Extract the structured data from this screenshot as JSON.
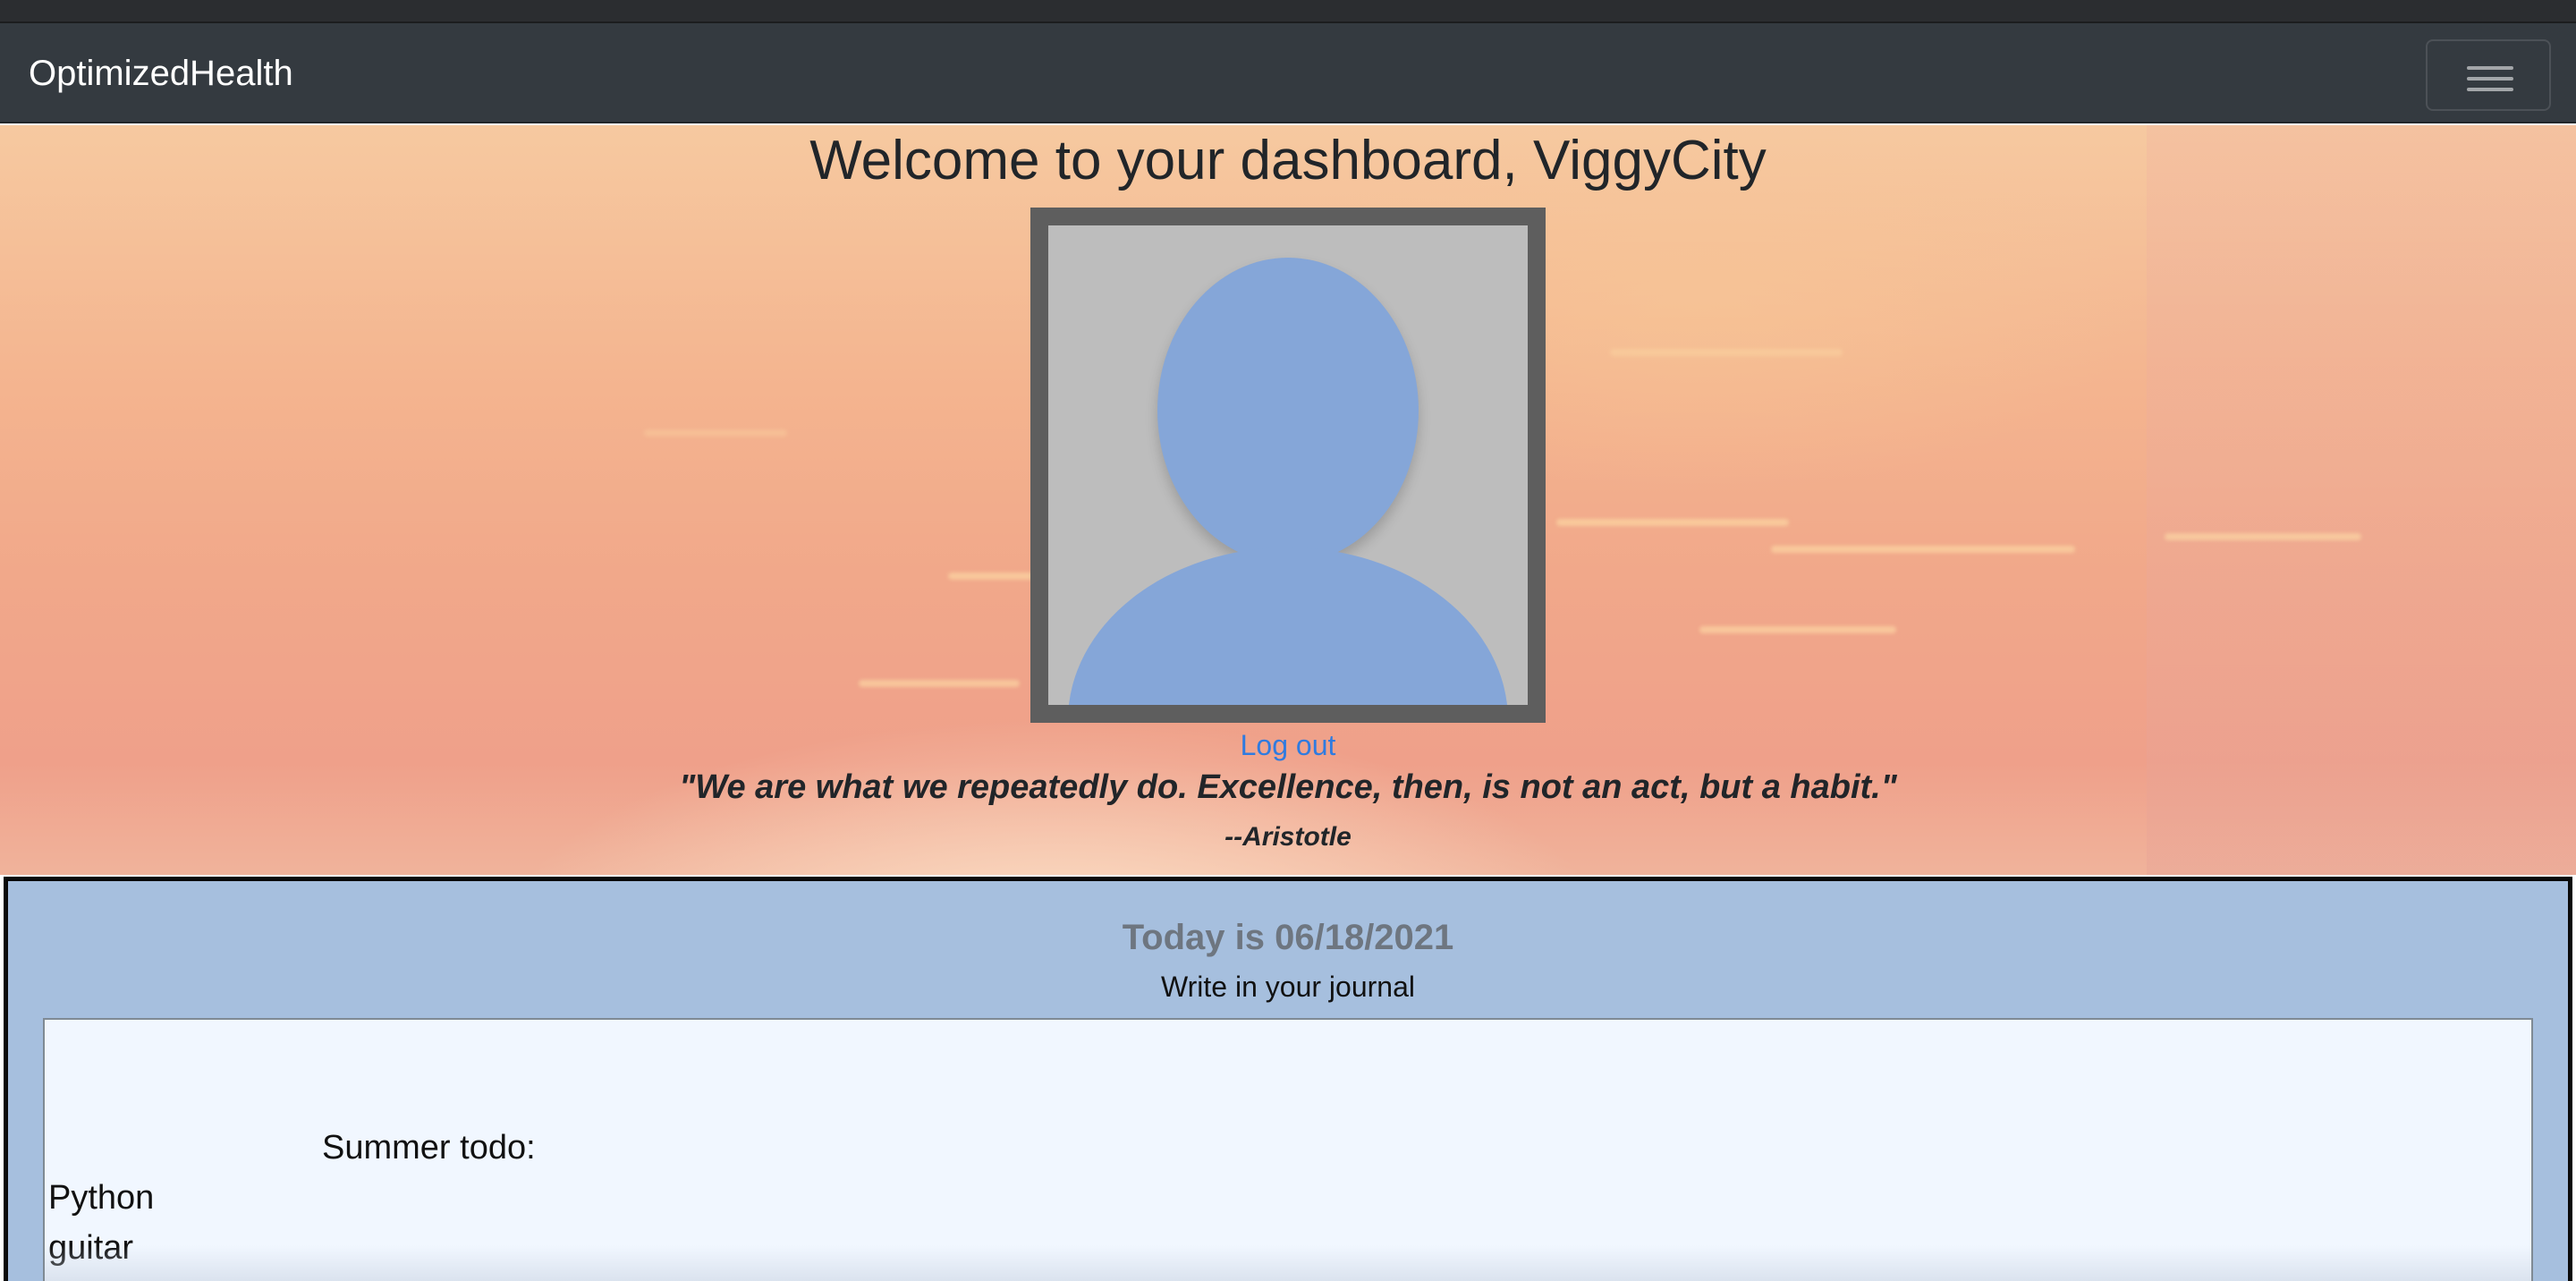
{
  "navbar": {
    "brand": "OptimizedHealth",
    "menu_icon": "hamburger-menu-icon"
  },
  "hero": {
    "welcome": "Welcome to your dashboard, ViggyCity",
    "avatar_icon": "default-user-avatar-icon",
    "logout_label": "Log out",
    "quote": "\"We are what we repeatedly do. Excellence, then, is not an act, but a habit.\"",
    "author": "--Aristotle"
  },
  "journal": {
    "date_text": "Today is 06/18/2021",
    "label": "Write in your journal",
    "lines": [
      "Summer todo:",
      "Python",
      "guitar"
    ]
  },
  "colors": {
    "navbar_bg": "#343a40",
    "link": "#2f7be0",
    "journal_bg": "#a6bfde",
    "avatar_fill": "#85a6d8"
  }
}
